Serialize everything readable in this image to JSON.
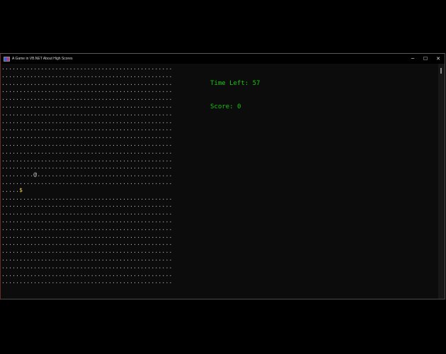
{
  "window": {
    "title": "A Game in VB.NET About High Scores",
    "minimize_glyph": "─",
    "maximize_glyph": "☐",
    "close_glyph": "✕"
  },
  "hud": {
    "time_left_label": "Time Left: ",
    "time_left_value": "57",
    "score_label": "Score: ",
    "score_value": "0"
  },
  "board": {
    "columns": 48,
    "rows": 29,
    "empty_char": ".",
    "player_char": "@",
    "player": {
      "row": 14,
      "col": 9
    },
    "coin_char": "$",
    "coin": {
      "row": 16,
      "col": 5
    },
    "colors": {
      "empty": "#bfbfbf",
      "player": "#c8c8c8",
      "coin": "#f1d24b",
      "hud": "#16c60c",
      "background": "#0c0c0c"
    }
  }
}
